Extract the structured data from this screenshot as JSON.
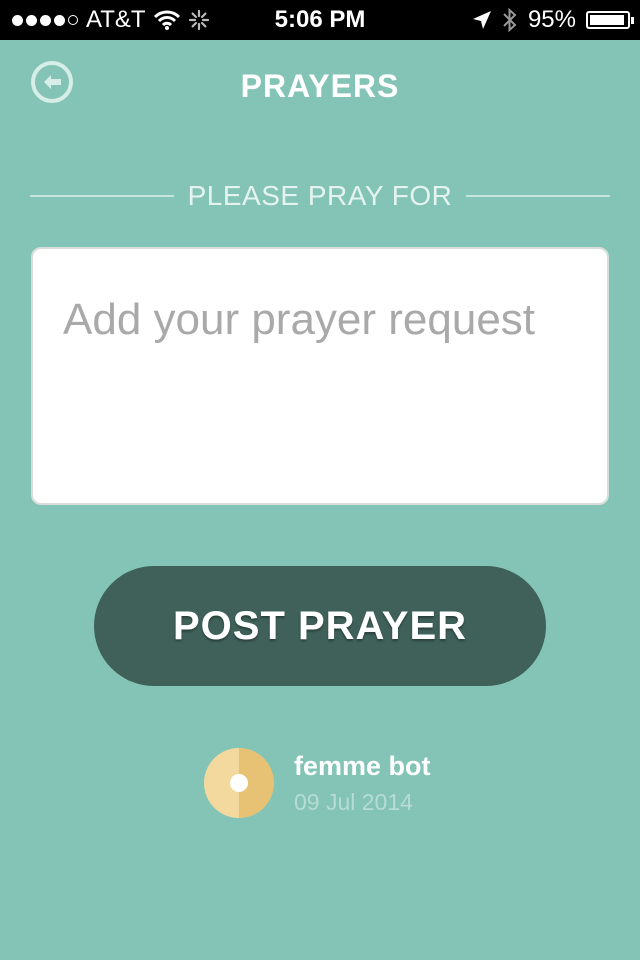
{
  "status_bar": {
    "carrier": "AT&T",
    "time": "5:06 PM",
    "battery": "95%",
    "battery_level": 0.95,
    "signal_bars": 4,
    "icons": [
      "wifi-icon",
      "activity-spinner-icon",
      "location-arrow-icon",
      "bluetooth-icon",
      "battery-icon"
    ]
  },
  "header": {
    "title": "PRAYERS",
    "back_icon": "back-arrow-circle-icon"
  },
  "form": {
    "section_label": "PLEASE PRAY FOR",
    "textarea_placeholder": "Add your prayer request",
    "textarea_value": "",
    "post_button_label": "POST PRAYER"
  },
  "user": {
    "name": "femme bot",
    "date": "09 Jul 2014",
    "avatar_icon": "avatar-icon"
  },
  "colors": {
    "background": "#83c4b6",
    "button": "#3f6159",
    "avatar_light": "#f4d99e",
    "avatar_dark": "#e8c274"
  }
}
